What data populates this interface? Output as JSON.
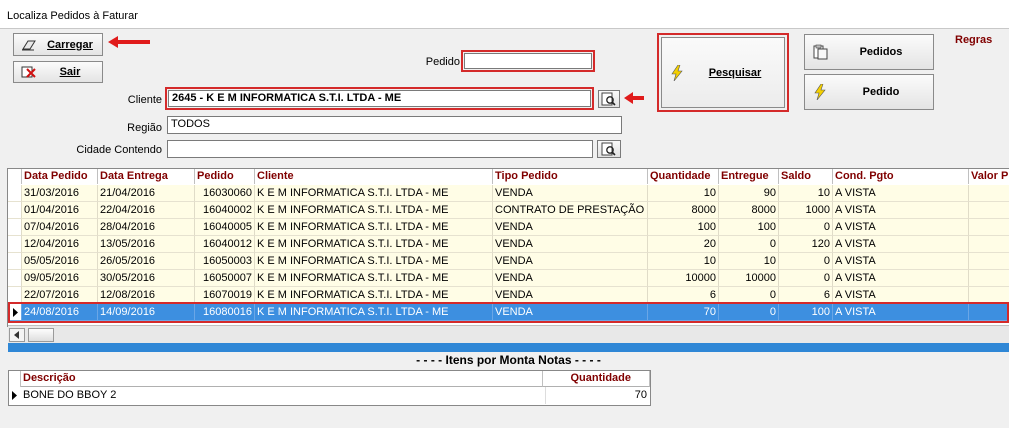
{
  "window": {
    "title": "Localiza Pedidos à Faturar"
  },
  "buttons": {
    "carregar": "Carregar",
    "sair": "Sair",
    "pesquisar": "Pesquisar",
    "pedidos": "Pedidos",
    "pedido": "Pedido"
  },
  "regras_label": "Regras",
  "form": {
    "pedido_label": "Pedido",
    "pedido_value": "",
    "cliente_label": "Cliente",
    "cliente_value": "2645 - K E M INFORMATICA S.T.I. LTDA - ME",
    "regiao_label": "Região",
    "regiao_value": "TODOS",
    "cidade_label": "Cidade Contendo",
    "cidade_value": ""
  },
  "orders_table": {
    "columns": [
      "Data Pedido",
      "Data Entrega",
      "Pedido",
      "Cliente",
      "Tipo Pedido",
      "Quantidade",
      "Entregue",
      "Saldo",
      "Cond. Pgto",
      "Valor P"
    ],
    "rows": [
      [
        "31/03/2016",
        "21/04/2016",
        "16030060",
        "K E M INFORMATICA S.T.I. LTDA - ME",
        "VENDA",
        "10",
        "90",
        "10",
        "A VISTA",
        ""
      ],
      [
        "01/04/2016",
        "22/04/2016",
        "16040002",
        "K E M INFORMATICA S.T.I. LTDA - ME",
        "CONTRATO DE PRESTAÇÃO I",
        "8000",
        "8000",
        "1000",
        "A VISTA",
        ""
      ],
      [
        "07/04/2016",
        "28/04/2016",
        "16040005",
        "K E M INFORMATICA S.T.I. LTDA - ME",
        "VENDA",
        "100",
        "100",
        "0",
        "A VISTA",
        ""
      ],
      [
        "12/04/2016",
        "13/05/2016",
        "16040012",
        "K E M INFORMATICA S.T.I. LTDA - ME",
        "VENDA",
        "20",
        "0",
        "120",
        "A VISTA",
        ""
      ],
      [
        "05/05/2016",
        "26/05/2016",
        "16050003",
        "K E M INFORMATICA S.T.I. LTDA - ME",
        "VENDA",
        "10",
        "10",
        "0",
        "A VISTA",
        ""
      ],
      [
        "09/05/2016",
        "30/05/2016",
        "16050007",
        "K E M INFORMATICA S.T.I. LTDA - ME",
        "VENDA",
        "10000",
        "10000",
        "0",
        "A VISTA",
        ""
      ],
      [
        "22/07/2016",
        "12/08/2016",
        "16070019",
        "K E M INFORMATICA S.T.I. LTDA - ME",
        "VENDA",
        "6",
        "0",
        "6",
        "A VISTA",
        ""
      ],
      [
        "24/08/2016",
        "14/09/2016",
        "16080016",
        "K E M INFORMATICA S.T.I. LTDA - ME",
        "VENDA",
        "70",
        "0",
        "100",
        "A VISTA",
        ""
      ]
    ],
    "selected_row": 7
  },
  "items_section": {
    "title": "- - - - Itens por Monta Notas - - - -",
    "columns": [
      "Descrição",
      "Quantidade"
    ],
    "rows": [
      [
        "BONE DO BBOY 2",
        "70"
      ]
    ]
  },
  "colors": {
    "header_text": "#800000",
    "selection": "#3d8fe0",
    "highlight_red": "#d42a2a",
    "row_bg": "#fffde6",
    "bar_blue": "#2f87d6"
  },
  "icons": [
    "load-icon",
    "exit-icon",
    "lightning-icon",
    "clipboard-icon",
    "search-doc-icon",
    "row-pointer-icon"
  ]
}
